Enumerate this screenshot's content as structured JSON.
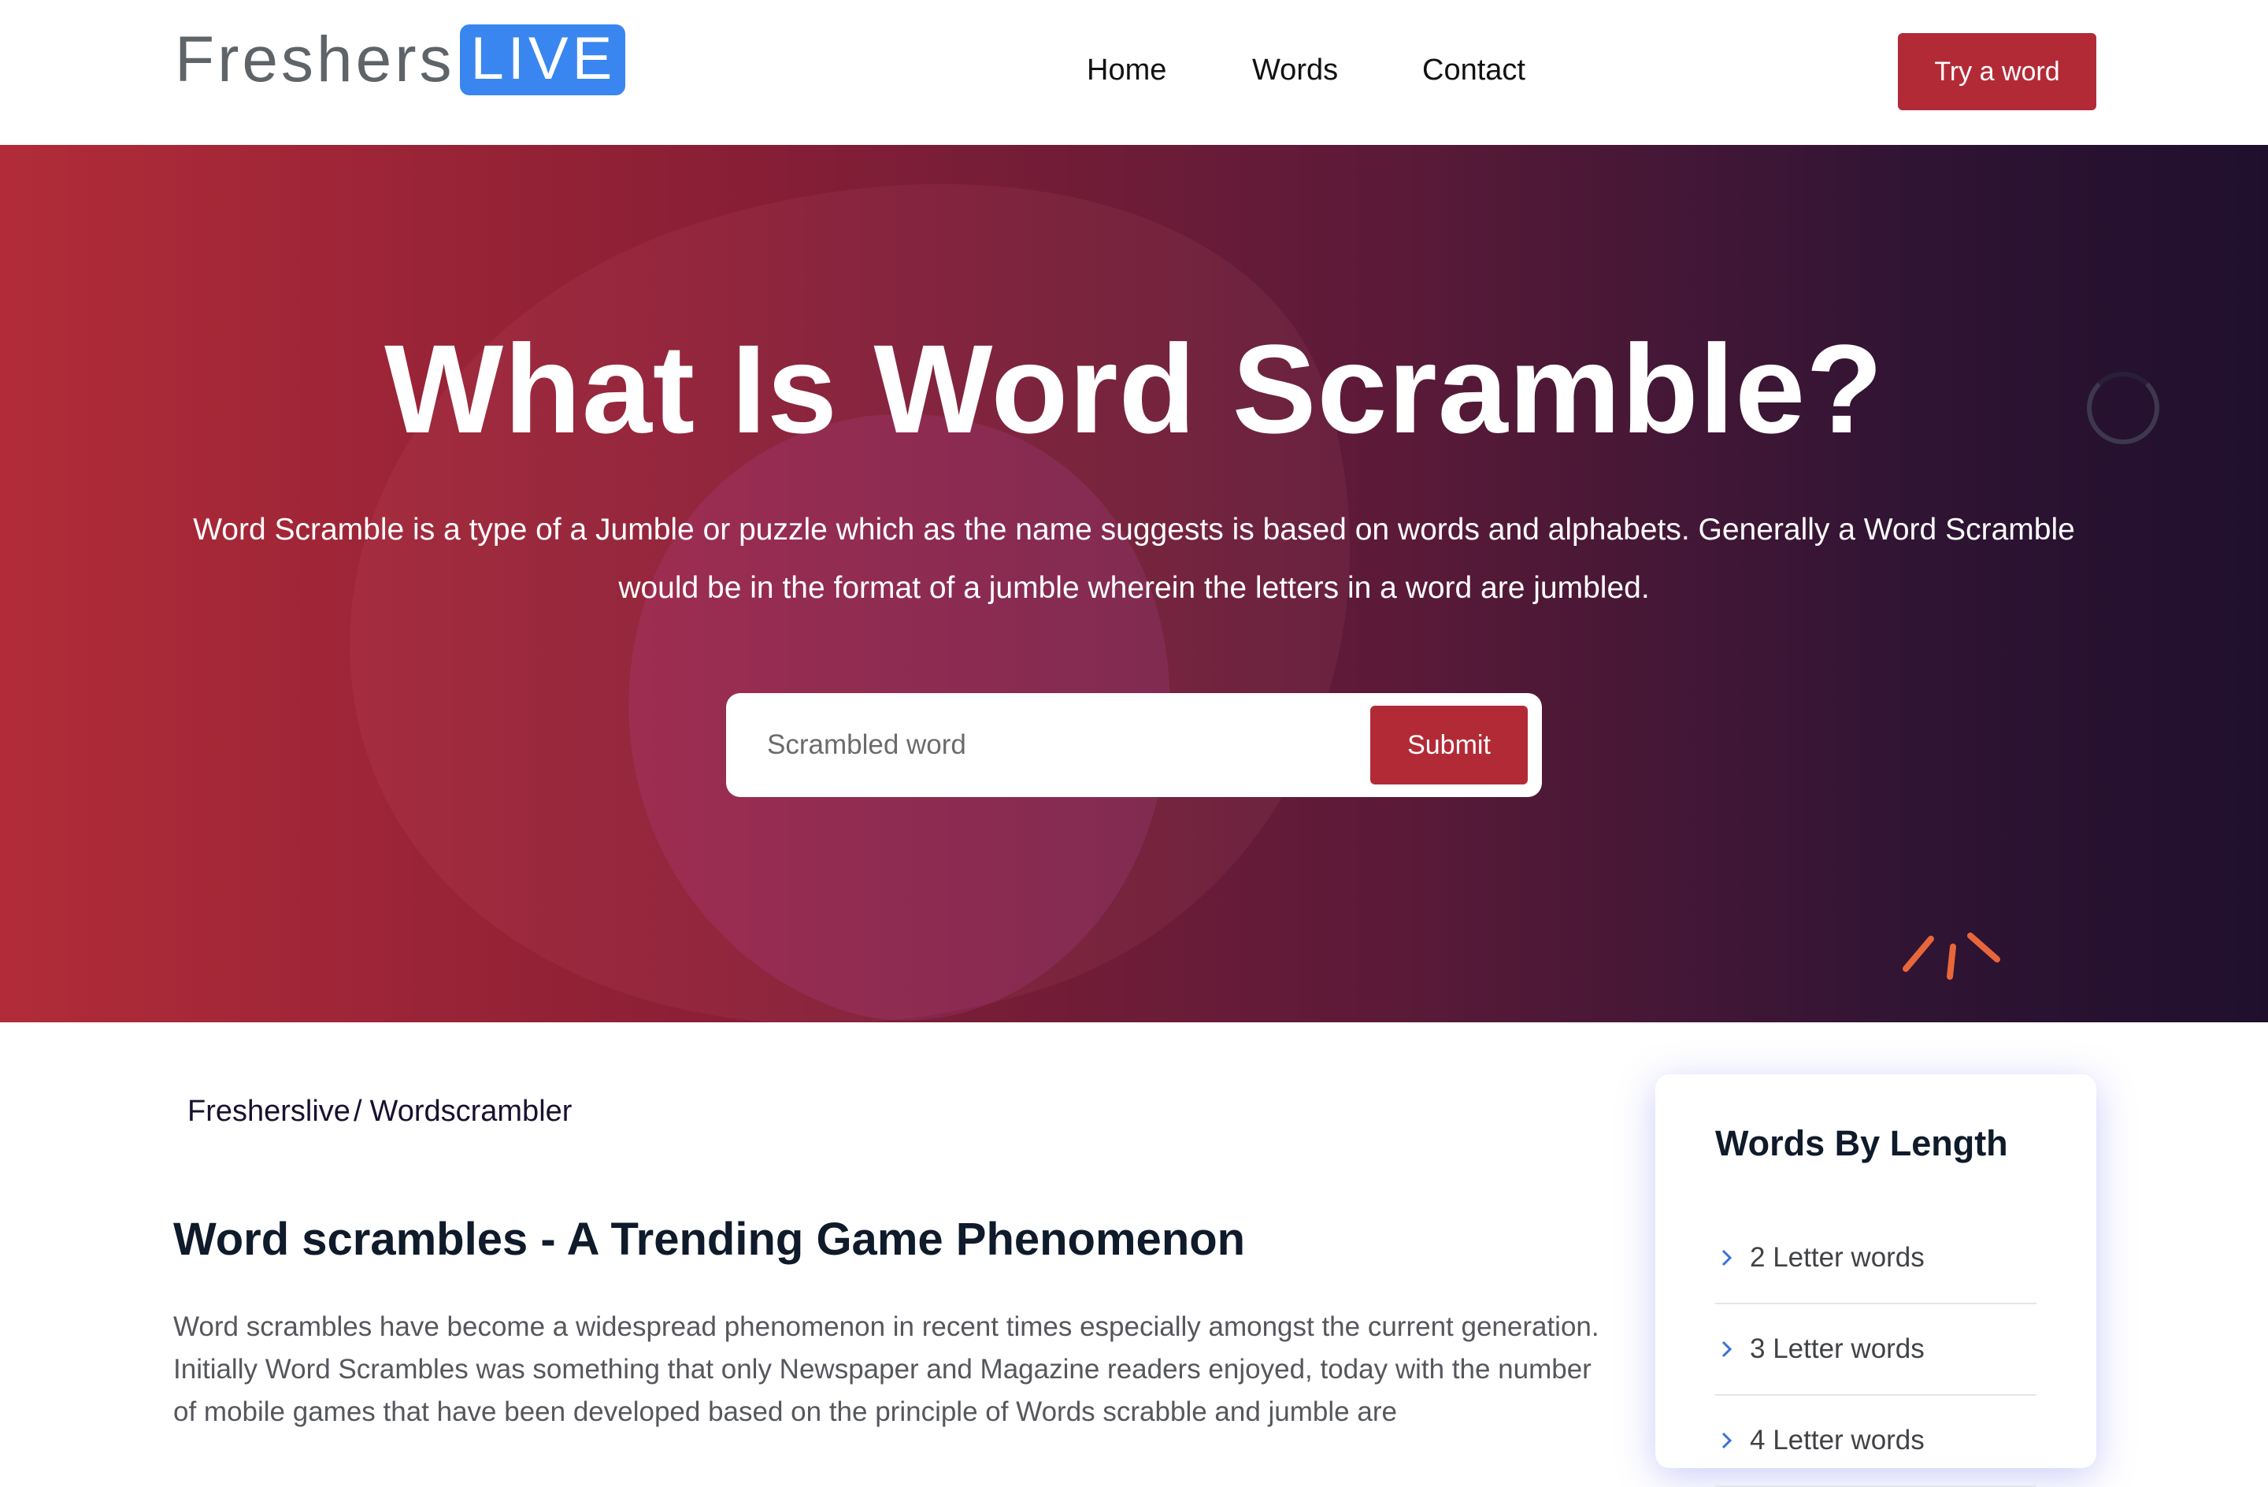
{
  "header": {
    "logo_text": "Freshers",
    "logo_badge": "LIVE",
    "nav": {
      "home": "Home",
      "words": "Words",
      "contact": "Contact"
    },
    "cta": "Try a word"
  },
  "hero": {
    "title": "What Is Word Scramble?",
    "description": "Word Scramble is a type of a Jumble or puzzle which as the name suggests is based on words and alphabets. Generally a Word Scramble would be in the format of a jumble wherein the letters in a word are jumbled.",
    "search": {
      "placeholder": "Scrambled word",
      "value": "",
      "submit": "Submit"
    }
  },
  "breadcrumb": {
    "items": [
      "Fresherslive",
      "Wordscrambler"
    ],
    "separator": "/"
  },
  "article": {
    "title": "Word scrambles - A Trending Game Phenomenon",
    "body": "Word scrambles have become a widespread phenomenon in recent times especially amongst the current generation. Initially Word Scrambles was something that only Newspaper and Magazine readers enjoyed, today with the number of mobile games that have been developed based on the principle of Words scrabble and jumble are"
  },
  "sidebar": {
    "title": "Words By Length",
    "items": [
      {
        "label": "2 Letter words"
      },
      {
        "label": "3 Letter words"
      },
      {
        "label": "4 Letter words"
      }
    ]
  },
  "colors": {
    "brand_red": "#b32a37",
    "logo_blue": "#3a86f0",
    "hero_start": "#b12c38",
    "hero_end": "#1f0f2d",
    "chevron_blue": "#3a6fd8",
    "sparkle_orange": "#e8673a"
  },
  "icons": {
    "loader": "spinner-ring-icon",
    "decoration": "sparkle-icon",
    "list_bullet": "chevron-right-icon"
  }
}
